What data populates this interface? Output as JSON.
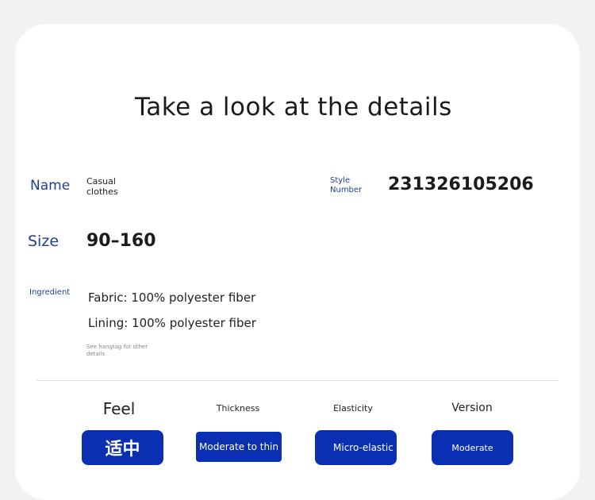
{
  "title": "Take a look at the details",
  "name": {
    "label": "Name",
    "value": "Casual clothes"
  },
  "style_number": {
    "label": "Style Number",
    "value": "231326105206"
  },
  "size": {
    "label": "Size",
    "value": "90–160"
  },
  "ingredient": {
    "label": "Ingredient",
    "fabric": "Fabric: 100% polyester fiber",
    "lining": "Lining: 100% polyester fiber",
    "note": "See hangtag for other details"
  },
  "attributes": {
    "feel": {
      "label": "Feel",
      "value": "适中"
    },
    "thickness": {
      "label": "Thickness",
      "value": "Moderate to thin"
    },
    "elasticity": {
      "label": "Elasticity",
      "value": "Micro-elastic"
    },
    "version": {
      "label": "Version",
      "value": "Moderate"
    }
  },
  "colors": {
    "accent": "#0b2fb3",
    "label_blue": "#1f3f8f",
    "background": "#f2f2f2"
  }
}
